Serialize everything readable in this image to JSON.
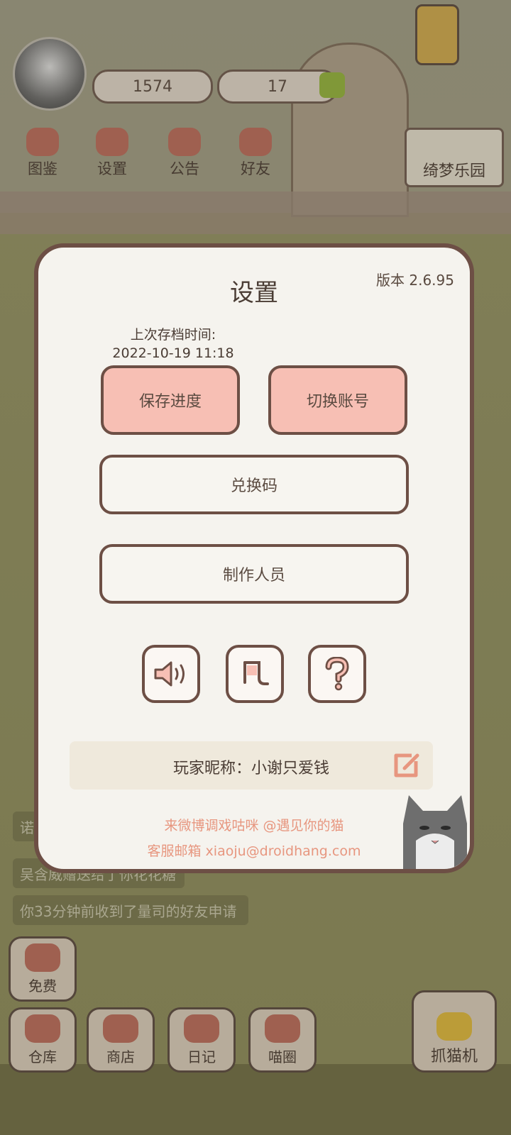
{
  "hud": {
    "fish_count": "1574",
    "heart_count": "17",
    "menu": [
      "图鉴",
      "设置",
      "公告",
      "好友"
    ],
    "park_label": "绮梦乐园"
  },
  "chat": [
    "诺",
    "吴含威赠送给了你花花糖",
    "你33分钟前收到了量司的好友申请"
  ],
  "free_label": "免费",
  "bottom_nav": [
    "仓库",
    "商店",
    "日记",
    "喵圈"
  ],
  "claw_label": "抓猫机",
  "settings": {
    "title": "设置",
    "version": "版本 2.6.95",
    "save_time_label": "上次存档时间:",
    "save_time_value": "2022-10-19 11:18",
    "save_button": "保存进度",
    "switch_button": "切换账号",
    "redeem_button": "兑换码",
    "credits_button": "制作人员",
    "icons": [
      "speaker-icon",
      "music-note-icon",
      "help-icon"
    ],
    "nickname": "玩家昵称：小谢只爱钱",
    "weibo_line": "来微博调戏咕咪 @遇见你的猫",
    "email_line": "客服邮箱 xiaoju@droidhang.com"
  },
  "colors": {
    "pink_button": "#f7bfb4",
    "border": "#6d4f45",
    "dialog_bg": "#f5f3ee",
    "link": "#e7967f"
  }
}
